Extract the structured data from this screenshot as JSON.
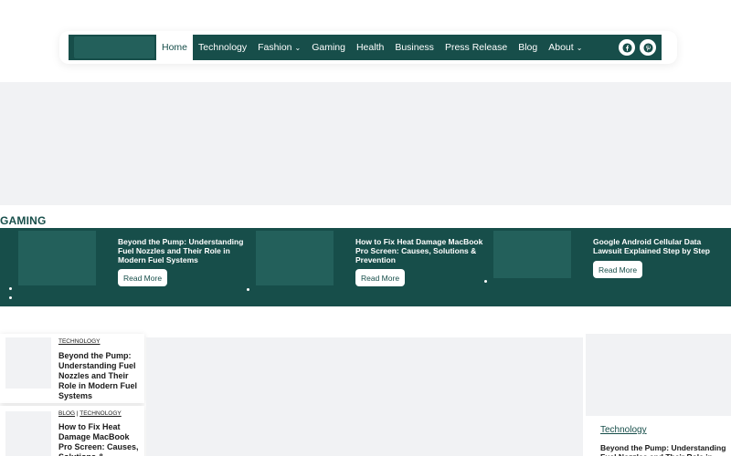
{
  "nav": {
    "items": [
      {
        "label": "Home",
        "active": true,
        "dropdown": false
      },
      {
        "label": "Technology",
        "active": false,
        "dropdown": false
      },
      {
        "label": "Fashion",
        "active": false,
        "dropdown": true
      },
      {
        "label": "Gaming",
        "active": false,
        "dropdown": false
      },
      {
        "label": "Health",
        "active": false,
        "dropdown": false
      },
      {
        "label": "Business",
        "active": false,
        "dropdown": false
      },
      {
        "label": "Press Release",
        "active": false,
        "dropdown": false
      },
      {
        "label": "Blog",
        "active": false,
        "dropdown": false
      },
      {
        "label": "About",
        "active": false,
        "dropdown": true
      }
    ],
    "socials": [
      "facebook-icon",
      "pinterest-icon"
    ]
  },
  "gaming": {
    "title": "GAMING",
    "slides": [
      {
        "title": "Beyond the Pump: Understanding Fuel Nozzles and Their Role in Modern Fuel Systems",
        "button": "Read More"
      },
      {
        "title": "How to Fix Heat Damage MacBook Pro Screen: Causes, Solutions & Prevention",
        "button": "Read More"
      },
      {
        "title": "Google Android Cellular Data Lawsuit Explained Step by Step",
        "button": "Read More"
      }
    ]
  },
  "list": [
    {
      "categories": [
        "TECHNOLOGY"
      ],
      "title": "Beyond the Pump: Understanding Fuel Nozzles and Their Role in Modern Fuel Systems"
    },
    {
      "categories": [
        "BLOG",
        "TECHNOLOGY"
      ],
      "title": "How to Fix Heat Damage MacBook Pro Screen: Causes, Solutions & Prevention"
    }
  ],
  "sidebar": {
    "category": "Technology",
    "title": "Beyond the Pump: Understanding Fuel Nozzles and Their Role in Modern Fuel Systems"
  },
  "colors": {
    "brand": "#174e4a",
    "placeholder": "#f1f2f4"
  }
}
